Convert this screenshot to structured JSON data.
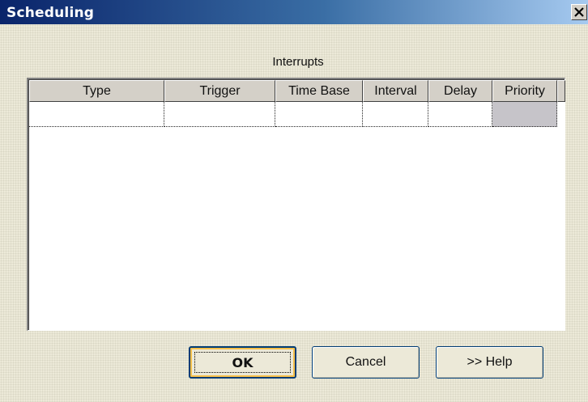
{
  "window": {
    "title": "Scheduling",
    "close_icon": "close-icon"
  },
  "caption": "Interrupts",
  "table": {
    "columns": [
      "Type",
      "Trigger",
      "Time Base",
      "Interval",
      "Delay",
      "Priority"
    ],
    "rows": [
      [
        "",
        "",
        "",
        "",
        "",
        ""
      ]
    ]
  },
  "buttons": {
    "ok": "OK",
    "cancel": "Cancel",
    "help": ">> Help"
  },
  "colors": {
    "selected_cell": "#c6c4c9",
    "default_button_highlight": "#f7c04a"
  }
}
